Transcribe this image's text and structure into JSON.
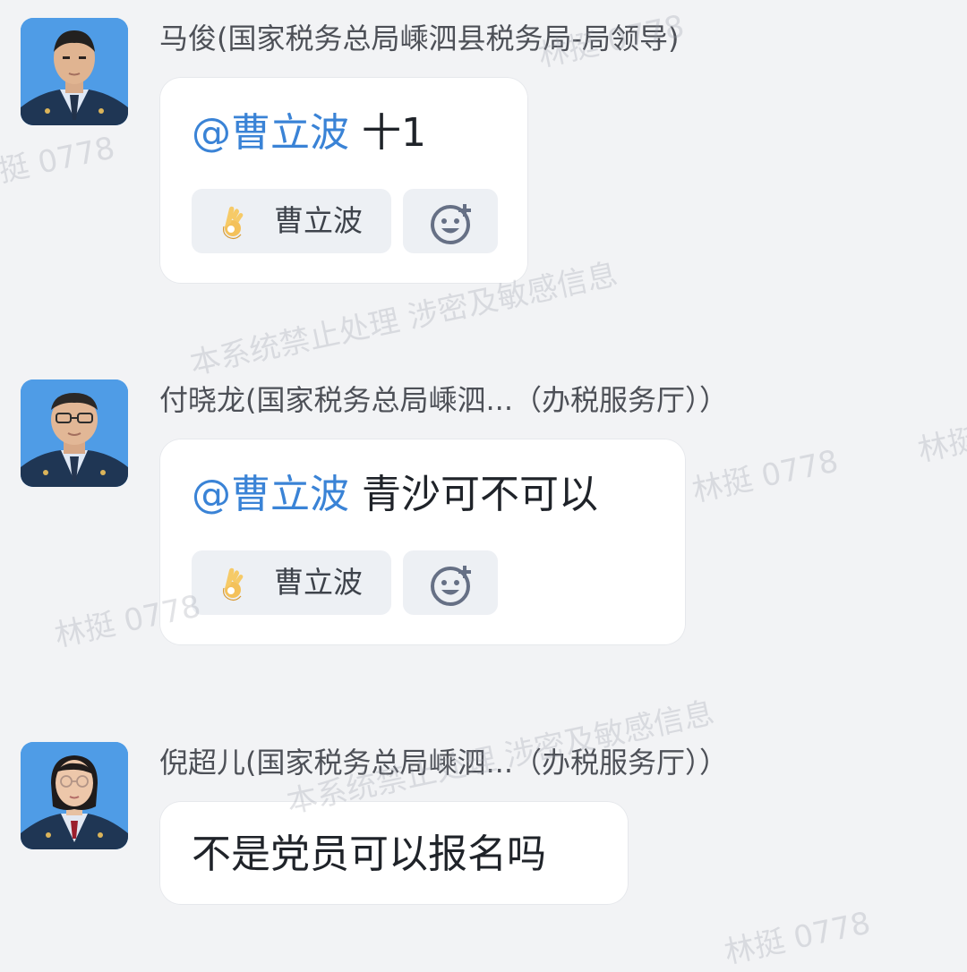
{
  "messages": [
    {
      "sender": "马俊(国家税务总局嵊泗县税务局-局领导)",
      "mention": "@曹立波",
      "text": "十1",
      "reaction": {
        "emoji": "ok-hand",
        "user": "曹立波"
      },
      "add_reaction_icon": "smile-plus-icon"
    },
    {
      "sender": "付晓龙(国家税务总局嵊泗...（办税服务厅））",
      "mention": "@曹立波",
      "text": "青沙可不可以",
      "reaction": {
        "emoji": "ok-hand",
        "user": "曹立波"
      },
      "add_reaction_icon": "smile-plus-icon"
    },
    {
      "sender": "倪超儿(国家税务总局嵊泗...（办税服务厅））",
      "text": "不是党员可以报名吗"
    }
  ],
  "watermarks": {
    "policy": "本系统禁止处理 涉密及敏感信息",
    "name": "林挺 0778"
  },
  "colors": {
    "background": "#f2f3f5",
    "mention": "#3a83d6",
    "bubble": "#ffffff",
    "reaction_bg": "#edf0f4"
  }
}
